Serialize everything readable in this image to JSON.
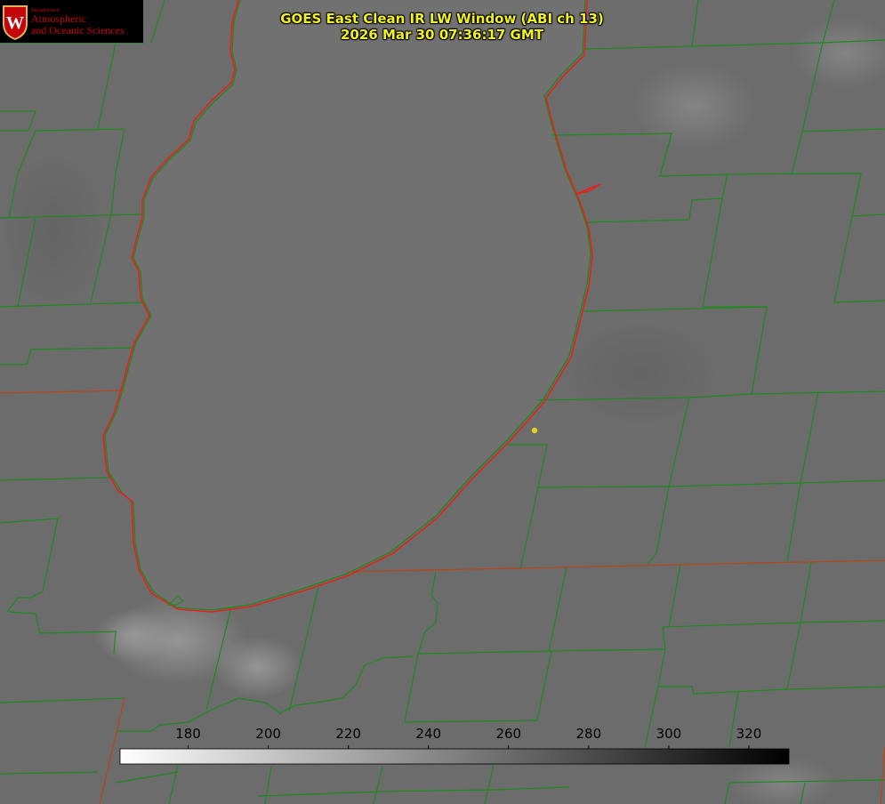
{
  "logo": {
    "dept_small": "Department of",
    "line1": "Atmospheric",
    "line2": "and Oceanic Sciences",
    "seal_letter": "W"
  },
  "title": {
    "line1": "GOES East Clean IR LW Window (ABI ch 13)",
    "line2": "2026 Mar 30 07:36:17 GMT"
  },
  "colorbar": {
    "min": 163,
    "max": 330,
    "tick_labels": [
      "180",
      "200",
      "220",
      "240",
      "260",
      "280",
      "300",
      "320"
    ],
    "ticks": [
      180,
      200,
      220,
      240,
      260,
      280,
      300,
      320
    ],
    "color_cold": "#ffffff",
    "color_warm": "#000000"
  },
  "colors": {
    "county_lines": "#1d8a1d",
    "state_lines": "#b5471b",
    "coastline": "#e8201c",
    "title_text": "#f2f21c",
    "marker": "#e6d21c",
    "logo_red": "#c5050c"
  },
  "icons": {
    "logo": "uw-crest-icon",
    "marker": "station-dot-icon"
  }
}
